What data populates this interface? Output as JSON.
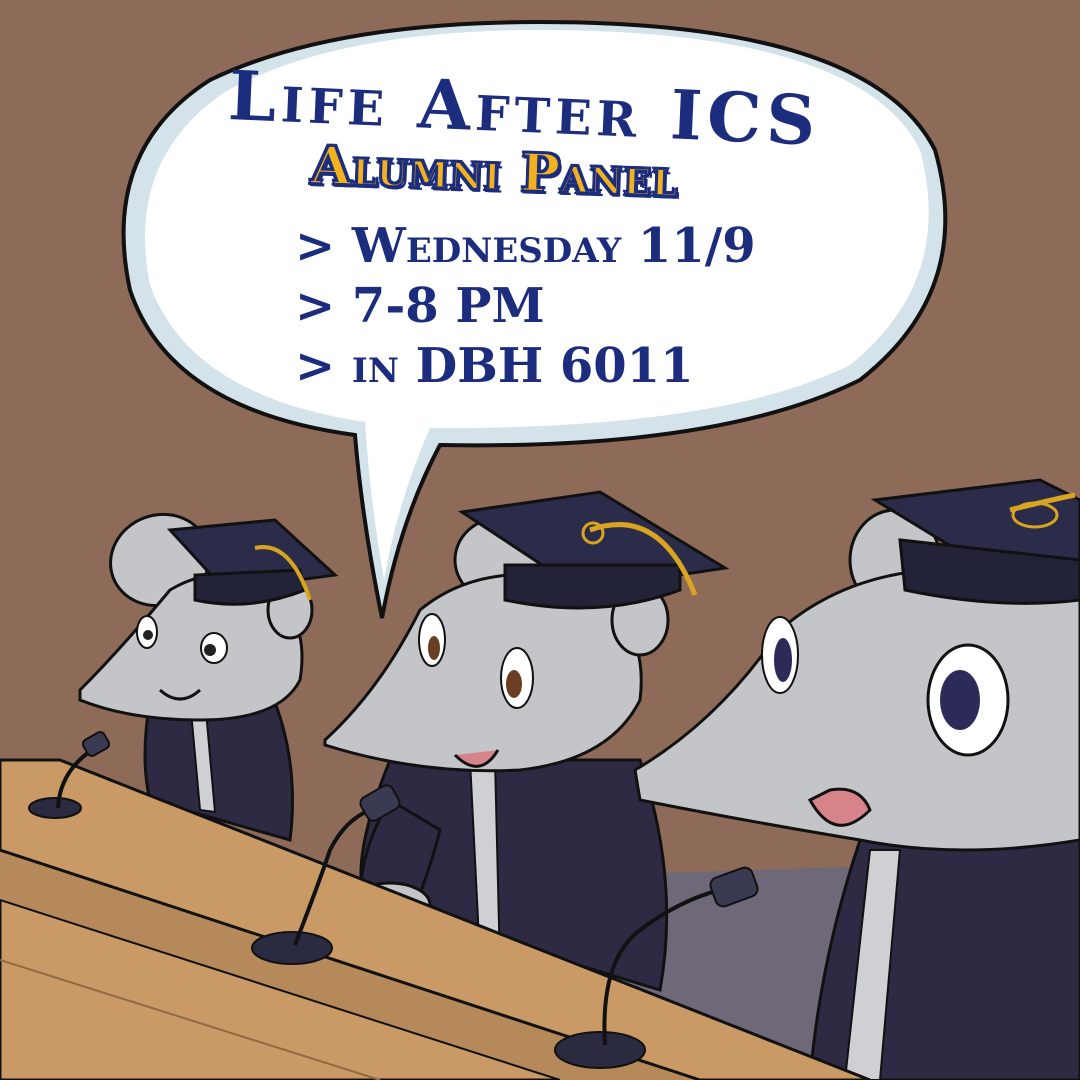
{
  "poster": {
    "title": "Life After ICS",
    "subtitle": "Alumni Panel",
    "details": [
      "> Wednesday 11/9",
      "> 7-8 PM",
      "> in DBH 6011"
    ]
  },
  "colors": {
    "wall": "#8d6b58",
    "table": "#c99a66",
    "title_blue": "#1d2d7d",
    "subtitle_gold": "#f2b21d",
    "gown": "#2e2a44",
    "anteater_gray": "#c4c5c9"
  }
}
